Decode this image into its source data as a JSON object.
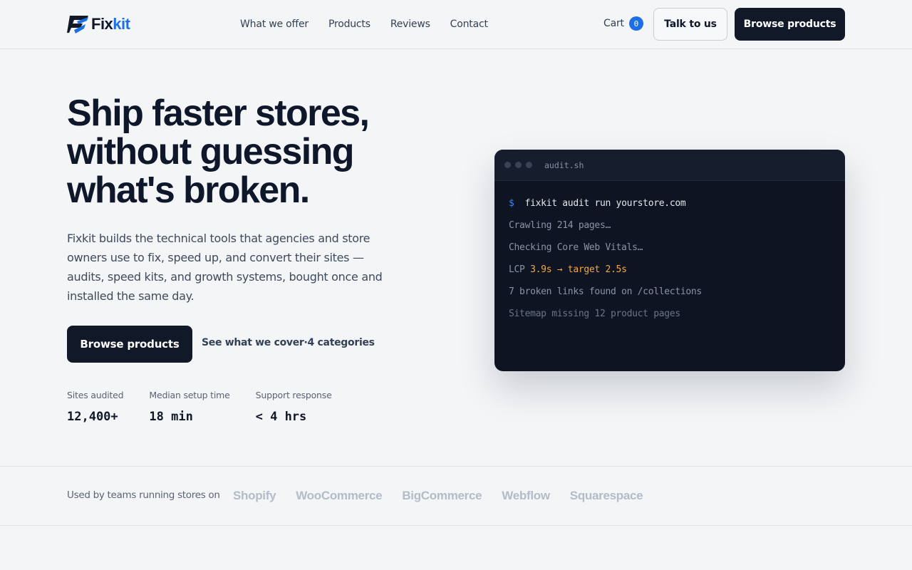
{
  "header": {
    "logo": {
      "text_main": "Fix",
      "text_accent": "kit"
    },
    "nav": [
      "What we offer",
      "Products",
      "Reviews",
      "Contact"
    ],
    "cart": {
      "label": "Cart",
      "count": "0"
    },
    "talk_button": "Talk to us",
    "browse_button": "Browse products"
  },
  "hero": {
    "title": "Ship faster stores, without guessing what's broken.",
    "subtitle": "Fixkit builds the technical tools that agencies and store owners use to fix, speed up, and convert their sites — audits, speed kits, and growth systems, bought once and installed the same day.",
    "primary_button": "Browse products",
    "cover_link": "See what we cover",
    "cover_separator": "·",
    "cover_count": "4 categories",
    "stats": [
      {
        "label": "Sites audited",
        "value": "12,400+"
      },
      {
        "label": "Median setup time",
        "value": "18 min"
      },
      {
        "label": "Support response",
        "value": "< 4 hrs"
      }
    ]
  },
  "terminal": {
    "filename": "audit.sh",
    "prompt": "$",
    "command": "fixkit audit run yourstore.com",
    "lines": {
      "crawl": "Crawling 214 pages…",
      "cwv": "Checking Core Web Vitals…",
      "lcp_label": "LCP ",
      "lcp_value": "3.9s → target 2.5s",
      "links": "7 broken links found on /collections",
      "sitemap": "Sitemap missing 12 product pages"
    }
  },
  "strip": {
    "label": "Used by teams running stores on",
    "brands": [
      "Shopify",
      "WooCommerce",
      "BigCommerce",
      "Webflow",
      "Squarespace"
    ]
  },
  "colors": {
    "accent": "#1d6fe8",
    "dark": "#111827",
    "background": "#f3f5f7",
    "warning": "#f5a742"
  }
}
